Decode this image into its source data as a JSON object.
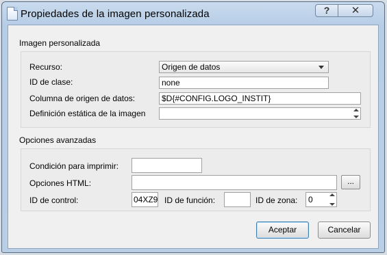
{
  "window": {
    "title": "Propiedades de la imagen personalizada",
    "help_label": "?",
    "close_label": "✕"
  },
  "imagen": {
    "group_title": "Imagen personalizada",
    "recurso_label": "Recurso:",
    "recurso_value": "Origen de datos",
    "clase_label": "ID de clase:",
    "clase_value": "none",
    "columna_label": "Columna de origen de datos:",
    "columna_value": "$D{#CONFIG.LOGO_INSTIT}",
    "definicion_label": "Definición estática de la imagen",
    "definicion_value": ""
  },
  "avanzadas": {
    "group_title": "Opciones avanzadas",
    "condicion_label": "Condición para imprimir:",
    "condicion_value": "",
    "html_label": "Opciones HTML:",
    "html_value": "",
    "browse_label": "...",
    "control_label": "ID de control:",
    "control_value": "04XZ9",
    "funcion_label": "ID de función:",
    "funcion_value": "",
    "zona_label": "ID de zona:",
    "zona_value": "0"
  },
  "buttons": {
    "accept": "Aceptar",
    "cancel": "Cancelar"
  }
}
